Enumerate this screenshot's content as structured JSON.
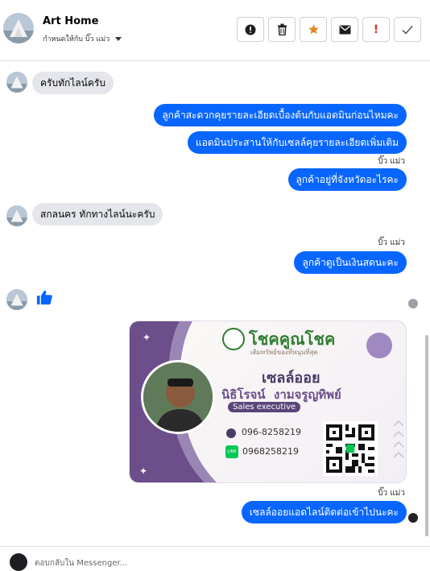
{
  "header": {
    "name": "Art Home",
    "assign_label": "กำหนดให้กับ บิ๊ว แม่ว"
  },
  "actions": [
    {
      "name": "report-icon",
      "glyph": "!"
    },
    {
      "name": "trash-icon",
      "glyph": "🗑"
    },
    {
      "name": "star-icon",
      "glyph": "★"
    },
    {
      "name": "mail-icon",
      "glyph": "✉"
    },
    {
      "name": "spam-icon",
      "glyph": "!"
    },
    {
      "name": "check-icon",
      "glyph": "✓"
    }
  ],
  "messages": {
    "m1": "ครับทักไลน์ครับ",
    "m2": "ลูกค้าสะดวกคุยรายละเอียดเบื้องต้นกับแอดมินก่อนไหมคะ",
    "m3": "แอดมินประสานให้กับเซลล์คุยรายละเอียดเพิ่มเติม",
    "seen1": "บิ๊ว แม่ว",
    "m4": "ลูกค้าอยู่ที่จังหวัดอะไรคะ",
    "m5": "สกลนคร ทักทางไลน์นะครับ",
    "seen2": "บิ๊ว แม่ว",
    "m6": "ลูกค้าดูเป็นเงินสดนะคะ",
    "seen3": "บิ๊ว แม่ว",
    "m7": "เซลล์ออยแอดไลน์ติดต่อเข้าไปนะคะ"
  },
  "card": {
    "brand": "โชคคูณโชค",
    "tagline": "เติมทรัพย์ของที่หนุนที่สุด",
    "nickname": "เซลล์ออย",
    "fullname": "นิธิโรจน์  งามจรูญทิพย์",
    "role": "Sales executive",
    "phone": "096-8258219",
    "line_id": "0968258219",
    "line_label": "LINE"
  },
  "composer": {
    "placeholder": "ตอบกลับใน Messenger..."
  },
  "colors": {
    "outgoing": "#0866ff",
    "incoming": "#e4e6eb",
    "card_purple": "#6b4e8a",
    "brand_green": "#2f7d32",
    "star": "#e08a1e",
    "spam": "#d93025"
  }
}
